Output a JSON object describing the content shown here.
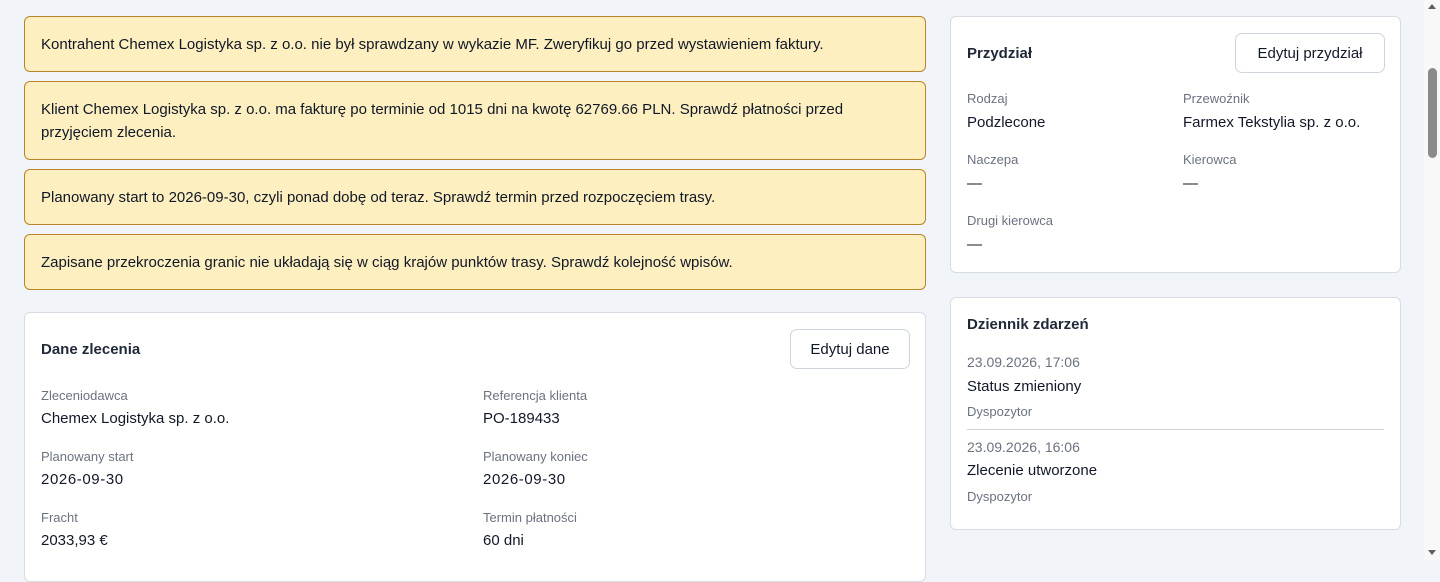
{
  "alerts": [
    "Kontrahent Chemex Logistyka sp. z o.o. nie był sprawdzany w wykazie MF. Zweryfikuj go przed wystawieniem faktury.",
    "Klient Chemex Logistyka sp. z o.o. ma fakturę po terminie od 1015 dni na kwotę 62769.66 PLN. Sprawdź płatności przed przyjęciem zlecenia.",
    "Planowany start to 2026-09-30, czyli ponad dobę od teraz. Sprawdź termin przed rozpoczęciem trasy.",
    "Zapisane przekroczenia granic nie układają się w ciąg krajów punktów trasy. Sprawdź kolejność wpisów."
  ],
  "dane": {
    "title": "Dane zlecenia",
    "edit_label": "Edytuj dane",
    "fields": {
      "zleceniodawca": {
        "label": "Zleceniodawca",
        "value": "Chemex Logistyka sp. z o.o."
      },
      "referencja": {
        "label": "Referencja klienta",
        "value": "PO-189433"
      },
      "start": {
        "label": "Planowany start",
        "value": "2026-09-30"
      },
      "koniec": {
        "label": "Planowany koniec",
        "value": "2026-09-30"
      },
      "fracht": {
        "label": "Fracht",
        "value": "2033,93 €"
      },
      "termin": {
        "label": "Termin płatności",
        "value": "60 dni"
      }
    }
  },
  "przydzial": {
    "title": "Przydział",
    "edit_label": "Edytuj przydział",
    "fields": {
      "rodzaj": {
        "label": "Rodzaj",
        "value": "Podzlecone"
      },
      "przewoznik": {
        "label": "Przewoźnik",
        "value": "Farmex Tekstylia sp. z o.o."
      },
      "naczepa": {
        "label": "Naczepa",
        "value": "—"
      },
      "kierowca": {
        "label": "Kierowca",
        "value": "—"
      },
      "drugi": {
        "label": "Drugi kierowca",
        "value": "—"
      }
    }
  },
  "dziennik": {
    "title": "Dziennik zdarzeń",
    "entries": [
      {
        "time": "23.09.2026, 17:06",
        "event": "Status zmieniony",
        "actor": "Dyspozytor"
      },
      {
        "time": "23.09.2026, 16:06",
        "event": "Zlecenie utworzone",
        "actor": "Dyspozytor"
      }
    ]
  }
}
